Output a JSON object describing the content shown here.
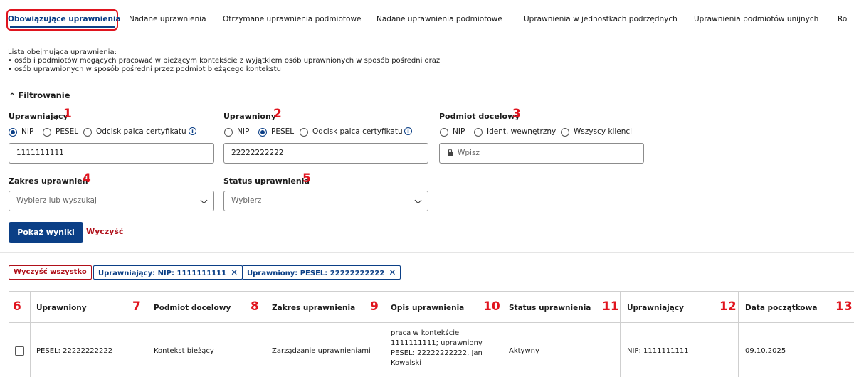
{
  "tabs": [
    {
      "label": "Obowiązujące uprawnienia",
      "active": true
    },
    {
      "label": "Nadane uprawnienia"
    },
    {
      "label": "Otrzymane uprawnienia podmiotowe"
    },
    {
      "label": "Nadane uprawnienia podmiotowe"
    },
    {
      "label": "Uprawnienia w jednostkach podrzędnych"
    },
    {
      "label": "Uprawnienia podmiotów unijnych"
    },
    {
      "label": "Ro"
    }
  ],
  "description": {
    "intro": "Lista obejmująca uprawnienia:",
    "bullets": [
      "• osób i podmiotów mogących pracować w bieżącym kontekście z wyjątkiem osób uprawnionych w sposób pośredni oraz",
      "• osób uprawnionych w sposób pośredni przez podmiot bieżącego kontekstu"
    ]
  },
  "filter": {
    "toggle_icon": "^",
    "title": "Filtrowanie",
    "granting": {
      "label": "Uprawniający",
      "num": "1",
      "options": [
        "NIP",
        "PESEL",
        "Odcisk palca certyfikatu"
      ],
      "selected": "NIP",
      "value": "1111111111"
    },
    "authorized": {
      "label": "Uprawniony",
      "num": "2",
      "options": [
        "NIP",
        "PESEL",
        "Odcisk palca certyfikatu"
      ],
      "selected": "PESEL",
      "value": "22222222222"
    },
    "target": {
      "label": "Podmiot docelowy",
      "num": "3",
      "options": [
        "NIP",
        "Ident. wewnętrzny",
        "Wszyscy klienci"
      ],
      "placeholder": "Wpisz"
    },
    "scope": {
      "label": "Zakres uprawnień",
      "num": "4",
      "placeholder": "Wybierz lub wyszukaj"
    },
    "status": {
      "label": "Status uprawnienia",
      "num": "5",
      "placeholder": "Wybierz"
    },
    "info_icon": "i",
    "show_button": "Pokaż wyniki",
    "clear_button": "Wyczyść"
  },
  "chips": {
    "clear_all": "Wyczyść wszystko",
    "items": [
      "Uprawniający: NIP: 1111111111",
      "Uprawniony: PESEL: 22222222222"
    ],
    "close_glyph": "✕"
  },
  "table": {
    "headers": [
      {
        "label": "",
        "num": "6"
      },
      {
        "label": "Uprawniony",
        "num": "7"
      },
      {
        "label": "Podmiot docelowy",
        "num": "8"
      },
      {
        "label": "Zakres uprawnienia",
        "num": "9"
      },
      {
        "label": "Opis uprawnienia",
        "num": "10"
      },
      {
        "label": "Status uprawnienia",
        "num": "11"
      },
      {
        "label": "Uprawniający",
        "num": "12"
      },
      {
        "label": "Data początkowa",
        "num": "13"
      }
    ],
    "rows": [
      {
        "authorized": "PESEL: 22222222222",
        "target": "Kontekst bieżący",
        "scope": "Zarządzanie uprawnieniami",
        "description": [
          "praca w kontekście",
          "1111111111; uprawniony",
          "PESEL: 22222222222, Jan",
          "Kowalski"
        ],
        "status": "Aktywny",
        "granting": "NIP: 1111111111",
        "start_date": "09.10.2025"
      }
    ]
  },
  "icons": {
    "lock": "lock-icon",
    "chevron": "chevron-down-icon",
    "info": "info-icon",
    "close": "close-icon"
  },
  "colors": {
    "primary": "#0b3f86",
    "danger": "#b0101a",
    "annotation": "#e0141e"
  }
}
